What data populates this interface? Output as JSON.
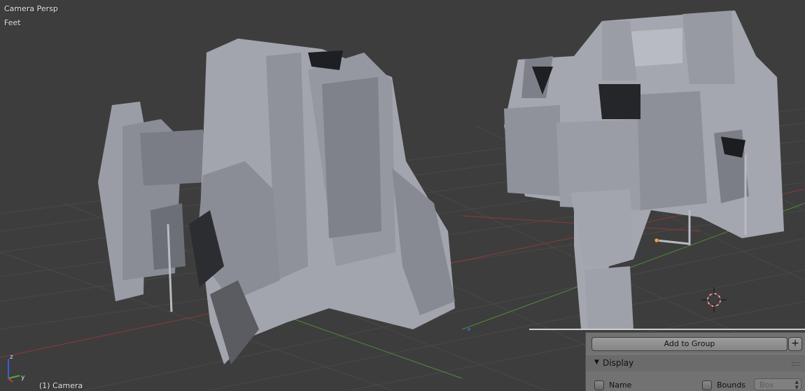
{
  "viewport": {
    "view_name": "Camera Persp",
    "units": "Feet",
    "active_object": "(1) Camera",
    "axis_labels": {
      "z": "z",
      "y": "y"
    },
    "colors": {
      "background": "#3d3d3d",
      "grid": "#4a4a4a",
      "x_axis": "#8c3a3a",
      "y_axis": "#4f8a3a",
      "model": "#9b9ea6",
      "model_dark": "#6f7279"
    }
  },
  "properties_panel": {
    "add_to_group_label": "Add to Group",
    "add_icon": "plus-icon",
    "display_section": {
      "title": "Display",
      "expanded": true,
      "name_checkbox": {
        "label": "Name",
        "checked": false
      },
      "bounds_checkbox": {
        "label": "Bounds",
        "checked": false
      },
      "bounds_type": "Box"
    }
  }
}
